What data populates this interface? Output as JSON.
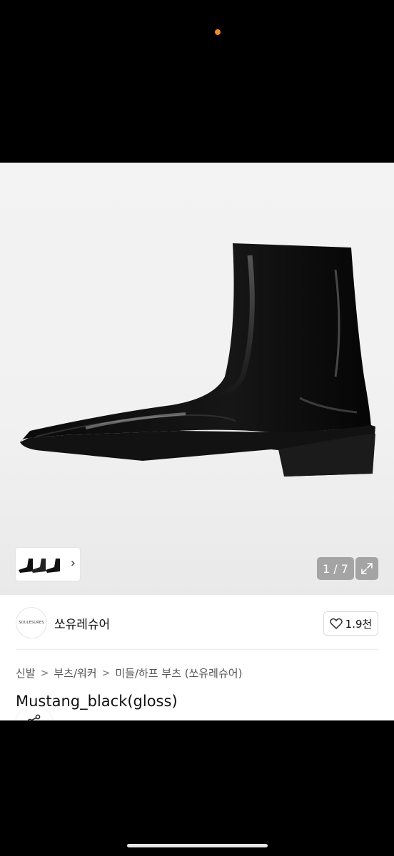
{
  "gallery": {
    "counter": "1 / 7",
    "thumb_chevron": "›",
    "icons": {
      "expand": "expand-icon",
      "chevron": "chevron-right-icon"
    }
  },
  "seller": {
    "logo_text": "SOULESURES",
    "name": "쏘유레슈어",
    "likes": "1.9천"
  },
  "breadcrumb": {
    "items": [
      "신발",
      "부츠/워커",
      "미들/하프 부츠 (쏘유레슈어)"
    ],
    "separator": ">"
  },
  "product": {
    "title": "Mustang_black(gloss)"
  },
  "colors": {
    "status_dot": "#f28a2e",
    "background": "#000000",
    "product_bg": "#f3f3f3"
  }
}
